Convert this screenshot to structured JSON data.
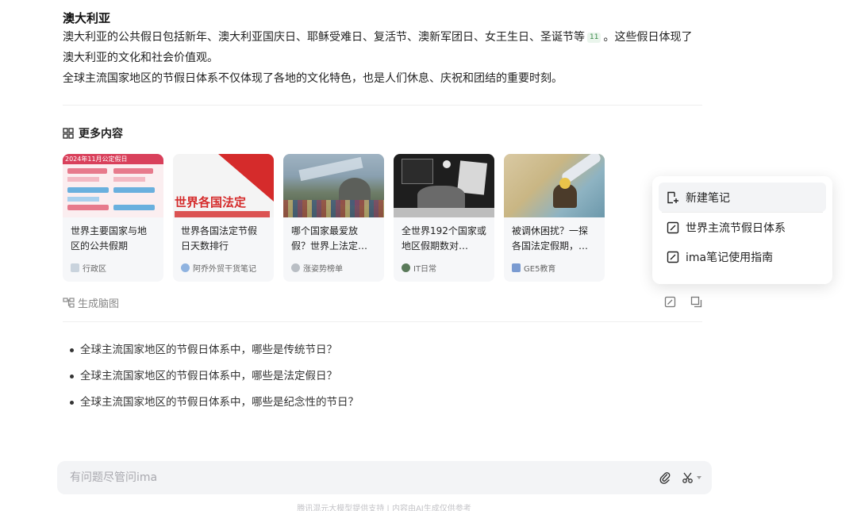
{
  "article": {
    "heading": "澳大利亚",
    "para1_before": "澳大利亚的公共假日包括新年、澳大利亚国庆日、耶稣受难日、复活节、澳新军团日、女王生日、圣诞节等",
    "cite": "11",
    "para1_after": "。这些假日体现了澳大利亚的文化和社会价值观。",
    "para2": "全球主流国家地区的节假日体系不仅体现了各地的文化特色，也是人们休息、庆祝和团结的重要时刻。"
  },
  "more": {
    "title": "更多内容",
    "cards": [
      {
        "title": "世界主要国家与地区的公共假期",
        "source": "行政区",
        "thumb_text": "2024年11月公定假日"
      },
      {
        "title": "世界各国法定节假日天数排行",
        "source": "阿乔外贸干货笔记",
        "thumb_text": "世界各国法定"
      },
      {
        "title": "哪个国家最爱放假？世界上法定…",
        "source": "涨姿势榜单"
      },
      {
        "title": "全世界192个国家或地区假期数对…",
        "source": "IT日常"
      },
      {
        "title": "被调休困扰？一探各国法定假期，…",
        "source": "GE5教育"
      }
    ]
  },
  "mindmap": {
    "label": "生成脑图"
  },
  "questions": [
    "全球主流国家地区的节假日体系中，哪些是传统节日？",
    "全球主流国家地区的节假日体系中，哪些是法定假日？",
    "全球主流国家地区的节假日体系中，哪些是纪念性的节日？"
  ],
  "input": {
    "placeholder": "有问题尽管问ima"
  },
  "footer": {
    "note": "腾讯混元大模型提供支持 | 内容由AI生成仅供参考"
  },
  "popup": {
    "items": [
      {
        "label": "新建笔记"
      },
      {
        "label": "世界主流节假日体系"
      },
      {
        "label": "ima笔记使用指南"
      }
    ]
  }
}
